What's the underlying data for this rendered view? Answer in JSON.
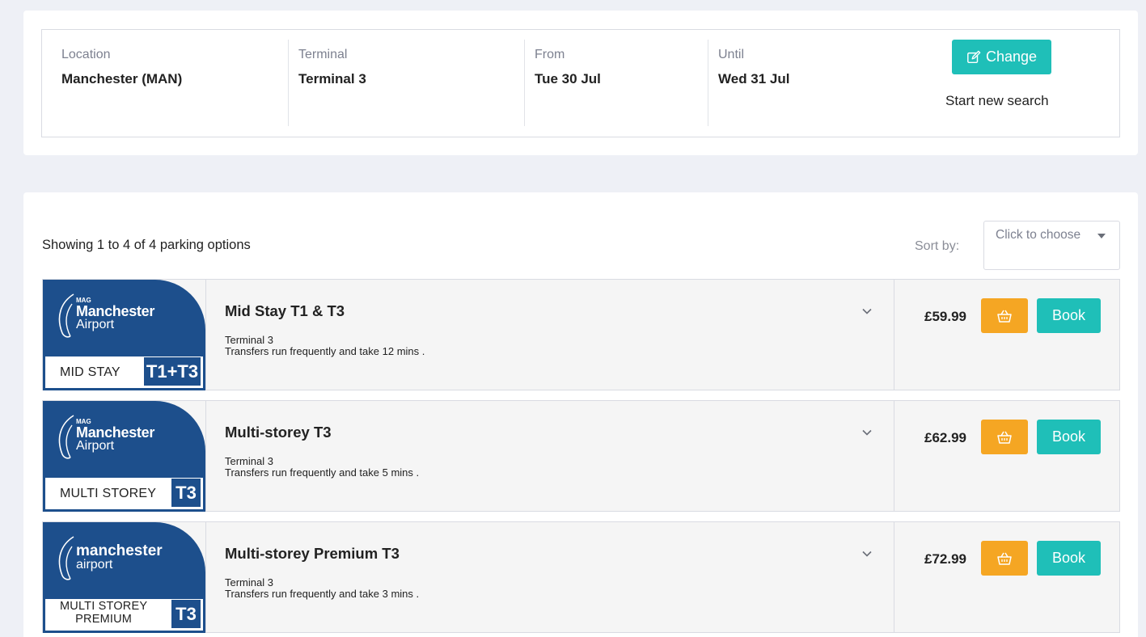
{
  "search": {
    "location": {
      "label": "Location",
      "value": "Manchester (MAN)"
    },
    "terminal": {
      "label": "Terminal",
      "value": "Terminal 3"
    },
    "from": {
      "label": "From",
      "value": "Tue 30 Jul"
    },
    "until": {
      "label": "Until",
      "value": "Wed 31 Jul"
    },
    "change_label": "Change",
    "new_search_label": "Start new search"
  },
  "results": {
    "showing_text": "Showing 1 to 4 of 4 parking options",
    "sort_label": "Sort by:",
    "sort_placeholder": "Click to choose",
    "items": [
      {
        "logo_mag": "MAG",
        "logo_name": "Manchester",
        "logo_sub": "Airport",
        "logo_type": "MID STAY",
        "logo_badge": "T1+T3",
        "title": "Mid Stay T1 & T3",
        "terminal": "Terminal 3",
        "transfer": "Transfers run frequently and take 12 mins .",
        "price": "£59.99",
        "book_label": "Book"
      },
      {
        "logo_mag": "MAG",
        "logo_name": "Manchester",
        "logo_sub": "Airport",
        "logo_type": "MULTI STOREY",
        "logo_badge": "T3",
        "title": "Multi-storey T3",
        "terminal": "Terminal 3",
        "transfer": "Transfers run frequently and take 5 mins .",
        "price": "£62.99",
        "book_label": "Book"
      },
      {
        "logo_name": "manchester",
        "logo_sub": "airport",
        "logo_type_line1": "MULTI STOREY",
        "logo_type_line2": "PREMIUM",
        "logo_badge": "T3",
        "title": "Multi-storey Premium T3",
        "terminal": "Terminal 3",
        "transfer": "Transfers run frequently and take 3 mins .",
        "price": "£72.99",
        "book_label": "Book"
      }
    ]
  },
  "colors": {
    "accent": "#1fbfb8",
    "basket": "#f5a623",
    "brand_blue": "#1d4f8c",
    "page_bg": "#eef0f6"
  },
  "icons": {
    "change": "edit-icon",
    "expand": "chevron-down-icon",
    "basket": "basket-icon",
    "sort": "caret-down-icon"
  }
}
